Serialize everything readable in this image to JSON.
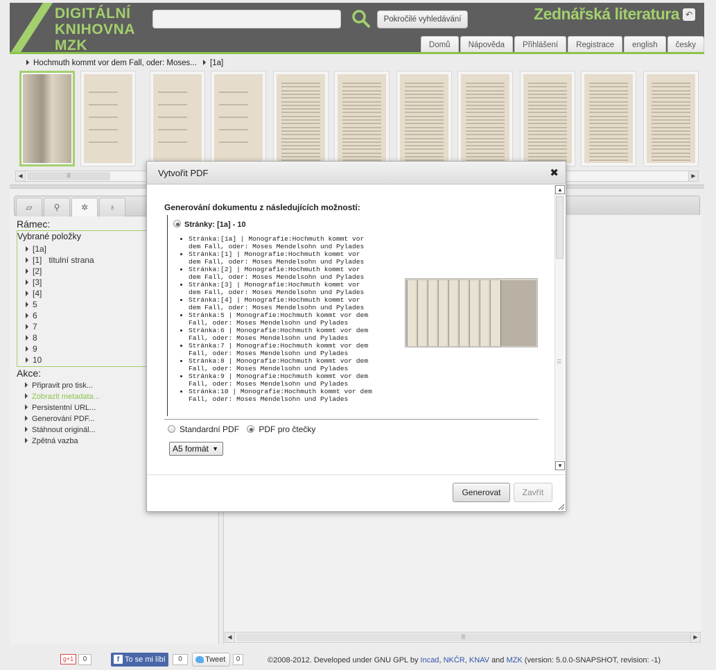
{
  "header": {
    "logo_lines": [
      "DIGITÁLNÍ",
      "KNIHOVNA",
      "MZK"
    ],
    "search_placeholder": "",
    "advanced_search": "Pokročilé vyhledávání",
    "site_title": "Zednářská literatura",
    "nav": [
      "Domů",
      "Nápověda",
      "Přihlášení",
      "Registrace",
      "english",
      "česky"
    ]
  },
  "breadcrumb": [
    "Hochmuth kommt vor dem Fall, oder: Moses...",
    "[1a]"
  ],
  "left": {
    "frame_label": "Rámec:",
    "selected_title": "Vybrané položky",
    "selected_items": [
      {
        "label": "[1a]",
        "sub": ""
      },
      {
        "label": "[1]",
        "sub": "titulní strana"
      },
      {
        "label": "[2]",
        "sub": ""
      },
      {
        "label": "[3]",
        "sub": ""
      },
      {
        "label": "[4]",
        "sub": ""
      },
      {
        "label": "5",
        "sub": ""
      },
      {
        "label": "6",
        "sub": ""
      },
      {
        "label": "7",
        "sub": ""
      },
      {
        "label": "8",
        "sub": ""
      },
      {
        "label": "9",
        "sub": ""
      },
      {
        "label": "10",
        "sub": ""
      }
    ],
    "actions_label": "Akce:",
    "actions": [
      {
        "label": "Připravit pro tisk...",
        "highlight": false
      },
      {
        "label": "Zobrazit metadata...",
        "highlight": true
      },
      {
        "label": "Persistentní URL...",
        "highlight": false
      },
      {
        "label": "Generování PDF...",
        "highlight": false
      },
      {
        "label": "Stáhnout originál...",
        "highlight": false
      },
      {
        "label": "Zpětná vazba",
        "highlight": false
      }
    ]
  },
  "modal": {
    "title": "Vytvořit PDF",
    "heading": "Generování dokumentu z následujících možností:",
    "pages_option": "Stránky: [1a] - 10",
    "pages": [
      [
        "Stránka:[1a] | Monografie:Hochmuth kommt vor",
        "dem Fall, oder: Moses Mendelsohn und Pylades"
      ],
      [
        "Stránka:[1] | Monografie:Hochmuth kommt vor",
        "dem Fall, oder: Moses Mendelsohn und Pylades"
      ],
      [
        "Stránka:[2] | Monografie:Hochmuth kommt vor",
        "dem Fall, oder: Moses Mendelsohn und Pylades"
      ],
      [
        "Stránka:[3] | Monografie:Hochmuth kommt vor",
        "dem Fall, oder: Moses Mendelsohn und Pylades"
      ],
      [
        "Stránka:[4] | Monografie:Hochmuth kommt vor",
        "dem Fall, oder: Moses Mendelsohn und Pylades"
      ],
      [
        "Stránka:5 | Monografie:Hochmuth kommt vor dem",
        "Fall, oder: Moses Mendelsohn und Pylades"
      ],
      [
        "Stránka:6 | Monografie:Hochmuth kommt vor dem",
        "Fall, oder: Moses Mendelsohn und Pylades"
      ],
      [
        "Stránka:7 | Monografie:Hochmuth kommt vor dem",
        "Fall, oder: Moses Mendelsohn und Pylades"
      ],
      [
        "Stránka:8 | Monografie:Hochmuth kommt vor dem",
        "Fall, oder: Moses Mendelsohn und Pylades"
      ],
      [
        "Stránka:9 | Monografie:Hochmuth kommt vor dem",
        "Fall, oder: Moses Mendelsohn und Pylades"
      ],
      [
        "Stránka:10 | Monografie:Hochmuth kommt vor dem",
        "Fall, oder: Moses Mendelsohn und Pylades"
      ]
    ],
    "format_standard": "Standardní PDF",
    "format_reader": "PDF pro čtečky",
    "selected_format": "reader",
    "size": "A5 formát",
    "generate": "Generovat",
    "close": "Zavřít"
  },
  "footer": {
    "gplus_label": "g+1",
    "gplus_count": "0",
    "fb_label": "To se mi líbí",
    "fb_count": "0",
    "tweet_label": "Tweet",
    "tweet_count": "0",
    "copyright_prefix": "©2008-2012. Developed under GNU GPL by",
    "link_incad": "Incad",
    "link_nkcr": "NKČR",
    "link_knav": "KNAV",
    "and": "and",
    "link_mzk": "MZK",
    "version": "(version: 5.0.0-SNAPSHOT, revision: -1)"
  },
  "colors": {
    "accent": "#a3d06d",
    "header_bg": "#5e5e5e",
    "link": "#3355aa"
  },
  "icons": {
    "search": "magnifier-icon",
    "close": "close-icon",
    "back": "back-arrow-icon"
  }
}
